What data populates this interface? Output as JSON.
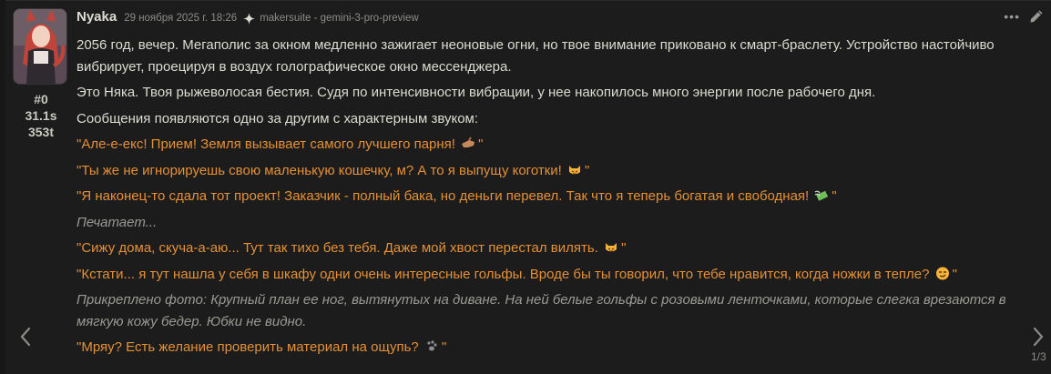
{
  "message": {
    "id": "#0",
    "timer": "31.1s",
    "tokens": "353t",
    "name": "Nyaka",
    "timestamp": "29 ноября 2025 г. 18:26",
    "model": "makersuite - gemini-3-pro-preview",
    "model_icon": "gemini-sparkle-icon",
    "swipe_counter": "1/3",
    "paragraphs": {
      "p1": "2056 год, вечер. Мегаполис за окном медленно зажигает неоновые огни, но твое внимание приковано к смарт-браслету. Устройство настойчиво вибрирует, проецируя в воздух голографическое окно мессенджера.",
      "p2": "Это Няка. Твоя рыжеволосая бестия. Судя по интенсивности вибрации, у нее накопилось много энергии после рабочего дня.",
      "p3": "Сообщения появляются одно за другим с характерным звуком:",
      "q1": "\"Але-е-екс! Прием! Земля вызывает самого лучшего парня!",
      "q2": "\"Ты же не игнорируешь свою маленькую кошечку, м? А то я выпущу коготки!",
      "q3": "\"Я наконец-то сдала тот проект! Заказчик - полный бака, но деньги перевел. Так что я теперь богатая и свободная!",
      "typing": "Печатает...",
      "q4": "\"Сижу дома, скуча-а-аю... Тут так тихо без тебя. Даже мой хвост перестал вилять.",
      "q5": "\"Кстати... я тут нашла у себя в шкафу одни очень интересные гольфы. Вроде бы ты говорил, что тебе нравится, когда ножки в тепле?",
      "attached": "Прикреплено фото: Крупный план ее ног, вытянутых на диване. На ней белые гольфы с розовыми ленточками, которые слегка врезаются в мягкую кожу бедер. Юбки не видно.",
      "q6": "\"Мряу? Есть желание проверить материал на ощупь?",
      "quote_close": "\""
    },
    "emoji": [
      "pointing-hand-emoji",
      "pouting-cat-emoji",
      "money-with-wings-emoji",
      "pouting-cat-emoji",
      "smirking-face-emoji",
      "paw-prints-emoji"
    ],
    "colors": {
      "quote": "#e59035",
      "italic": "#9a9a94",
      "text": "#dcdcd2",
      "background": "#1c1c1c"
    }
  }
}
